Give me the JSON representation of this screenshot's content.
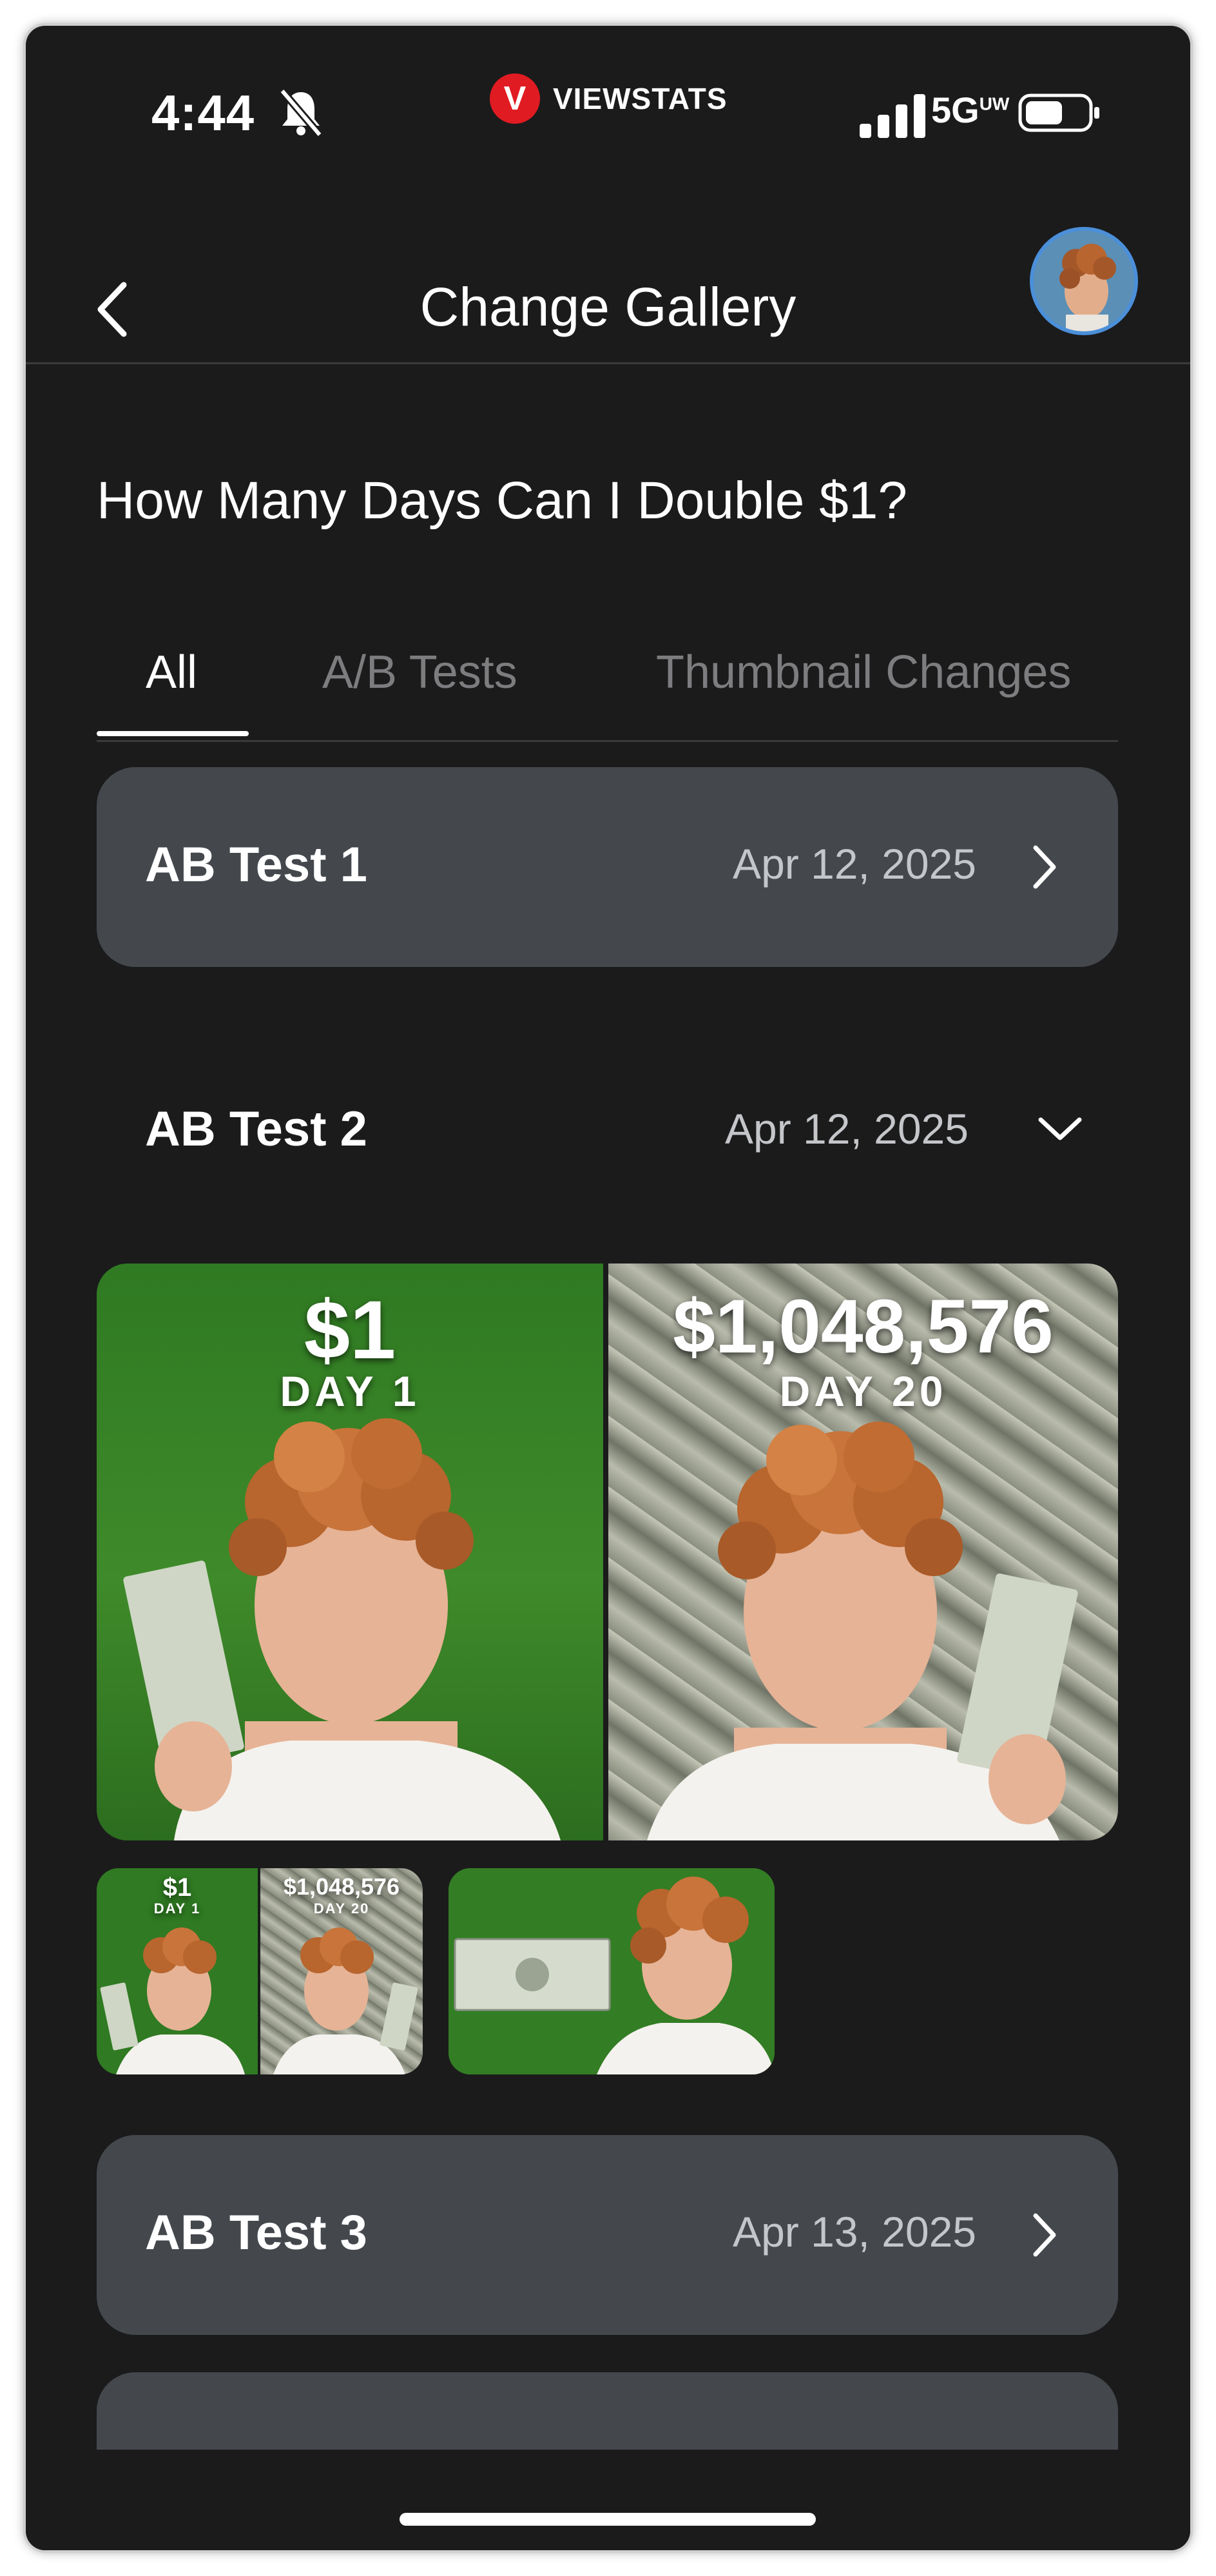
{
  "status_bar": {
    "time": "4:44",
    "brand": "VIEWSTATS",
    "brand_logo_letter": "V",
    "network": "5G",
    "network_sup": "UW"
  },
  "header": {
    "title": "Change Gallery",
    "back_icon": "chevron-left-icon"
  },
  "video": {
    "title": "How Many Days Can I Double $1?"
  },
  "tabs": [
    {
      "label": "All",
      "active": true
    },
    {
      "label": "A/B Tests",
      "active": false
    },
    {
      "label": "Thumbnail Changes",
      "active": false
    }
  ],
  "tests": [
    {
      "title": "AB Test 1",
      "date": "Apr 12, 2025",
      "expanded": false
    },
    {
      "title": "AB Test 2",
      "date": "Apr 12, 2025",
      "expanded": true
    },
    {
      "title": "AB Test 3",
      "date": "Apr 13, 2025",
      "expanded": false
    }
  ],
  "thumbnail": {
    "left_amount": "$1",
    "left_day": "DAY 1",
    "right_amount": "$1,048,576",
    "right_day": "DAY 20",
    "small_left_amount": "$1",
    "small_left_day": "DAY 1",
    "small_right_amount": "$1,048,576",
    "small_right_day": "DAY 20"
  },
  "colors": {
    "background": "#1b1b1c",
    "card": "#44484d",
    "accent_red": "#e11b22",
    "grass": "#2f7a22"
  }
}
